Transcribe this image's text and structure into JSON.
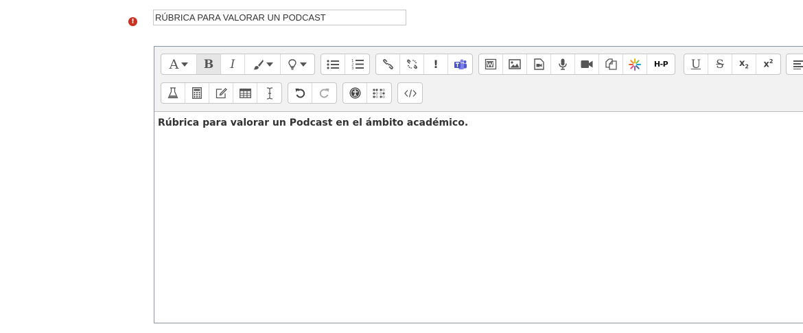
{
  "form": {
    "required_marker": "!",
    "name_value": "RÚBRICA PARA VALORAR UN PODCAST"
  },
  "toolbar": {
    "font_label": "A",
    "bold_label": "B",
    "italic_label": "I",
    "alert_label": "!",
    "h5p_label": "H-P",
    "underline_label": "U",
    "strike_label": "S",
    "subscript_label": "x",
    "subscript_mark": "2",
    "superscript_label": "x",
    "superscript_mark": "2",
    "icons": {
      "font": "font-icon",
      "bold": "bold-icon",
      "italic": "italic-icon",
      "text_color": "brush-icon",
      "styles": "lightbulb-icon",
      "unordered_list": "bullet-list-icon",
      "ordered_list": "numbered-list-icon",
      "link": "link-icon",
      "unlink": "unlink-icon",
      "alert": "exclamation-icon",
      "teams": "teams-icon",
      "word_paste": "word-icon",
      "image": "image-icon",
      "media": "media-file-icon",
      "record_audio": "microphone-icon",
      "record_video": "video-camera-icon",
      "manage_files": "files-icon",
      "loading": "spinner-icon",
      "h5p": "h5p-icon",
      "underline": "underline-icon",
      "strikethrough": "strikethrough-icon",
      "subscript": "subscript-icon",
      "superscript": "superscript-icon",
      "align": "align-icon",
      "chemistry": "flask-icon",
      "calculator": "calculator-icon",
      "edit_equation": "edit-icon",
      "table": "table-icon",
      "cursor": "text-cursor-icon",
      "undo": "undo-icon",
      "redo": "redo-icon",
      "accessibility": "accessibility-icon",
      "braille": "braille-icon",
      "html": "code-icon"
    }
  },
  "editor": {
    "content_text": "Rúbrica para valorar un Podcast en el ámbito académico."
  },
  "colors": {
    "toolbar_bg": "#f2f2f2",
    "required_red": "#ca3120",
    "teams_purple": "#5059c9"
  }
}
